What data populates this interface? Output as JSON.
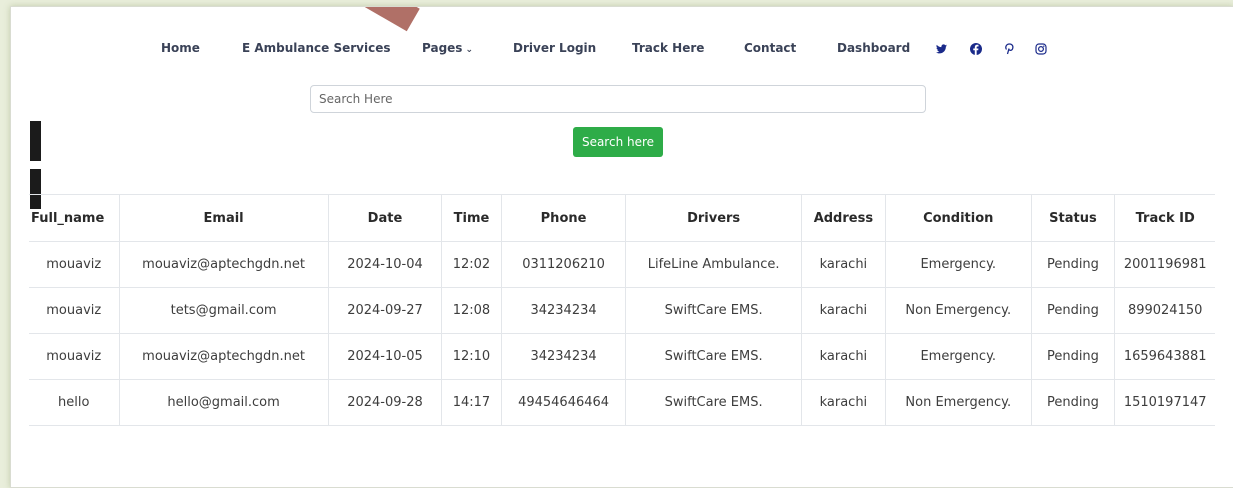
{
  "nav": {
    "links": [
      {
        "label": "Home"
      },
      {
        "label": "E Ambulance Services"
      },
      {
        "label": "Pages"
      },
      {
        "label": "Driver Login"
      },
      {
        "label": "Track Here"
      },
      {
        "label": "Contact"
      },
      {
        "label": "Dashboard"
      }
    ],
    "social": [
      "twitter-icon",
      "facebook-icon",
      "pinterest-icon",
      "instagram-icon"
    ]
  },
  "search": {
    "placeholder": "Search Here",
    "button_label": "Search here"
  },
  "colors": {
    "button_green": "#2eac48",
    "social_blue": "#1a2a8a",
    "page_bg": "#e9eedb"
  },
  "table": {
    "columns": [
      "Full_name",
      "Email",
      "Date",
      "Time",
      "Phone",
      "Drivers",
      "Address",
      "Condition",
      "Status",
      "Track ID"
    ],
    "rows": [
      [
        "mouaviz",
        "mouaviz@aptechgdn.net",
        "2024-10-04",
        "12:02",
        "0311206210",
        "LifeLine Ambulance.",
        "karachi",
        "Emergency.",
        "Pending",
        "2001196981"
      ],
      [
        "mouaviz",
        "tets@gmail.com",
        "2024-09-27",
        "12:08",
        "34234234",
        "SwiftCare EMS.",
        "karachi",
        "Non Emergency.",
        "Pending",
        "899024150"
      ],
      [
        "mouaviz",
        "mouaviz@aptechgdn.net",
        "2024-10-05",
        "12:10",
        "34234234",
        "SwiftCare EMS.",
        "karachi",
        "Emergency.",
        "Pending",
        "1659643881"
      ],
      [
        "hello",
        "hello@gmail.com",
        "2024-09-28",
        "14:17",
        "49454646464",
        "SwiftCare EMS.",
        "karachi",
        "Non Emergency.",
        "Pending",
        "1510197147"
      ]
    ]
  }
}
